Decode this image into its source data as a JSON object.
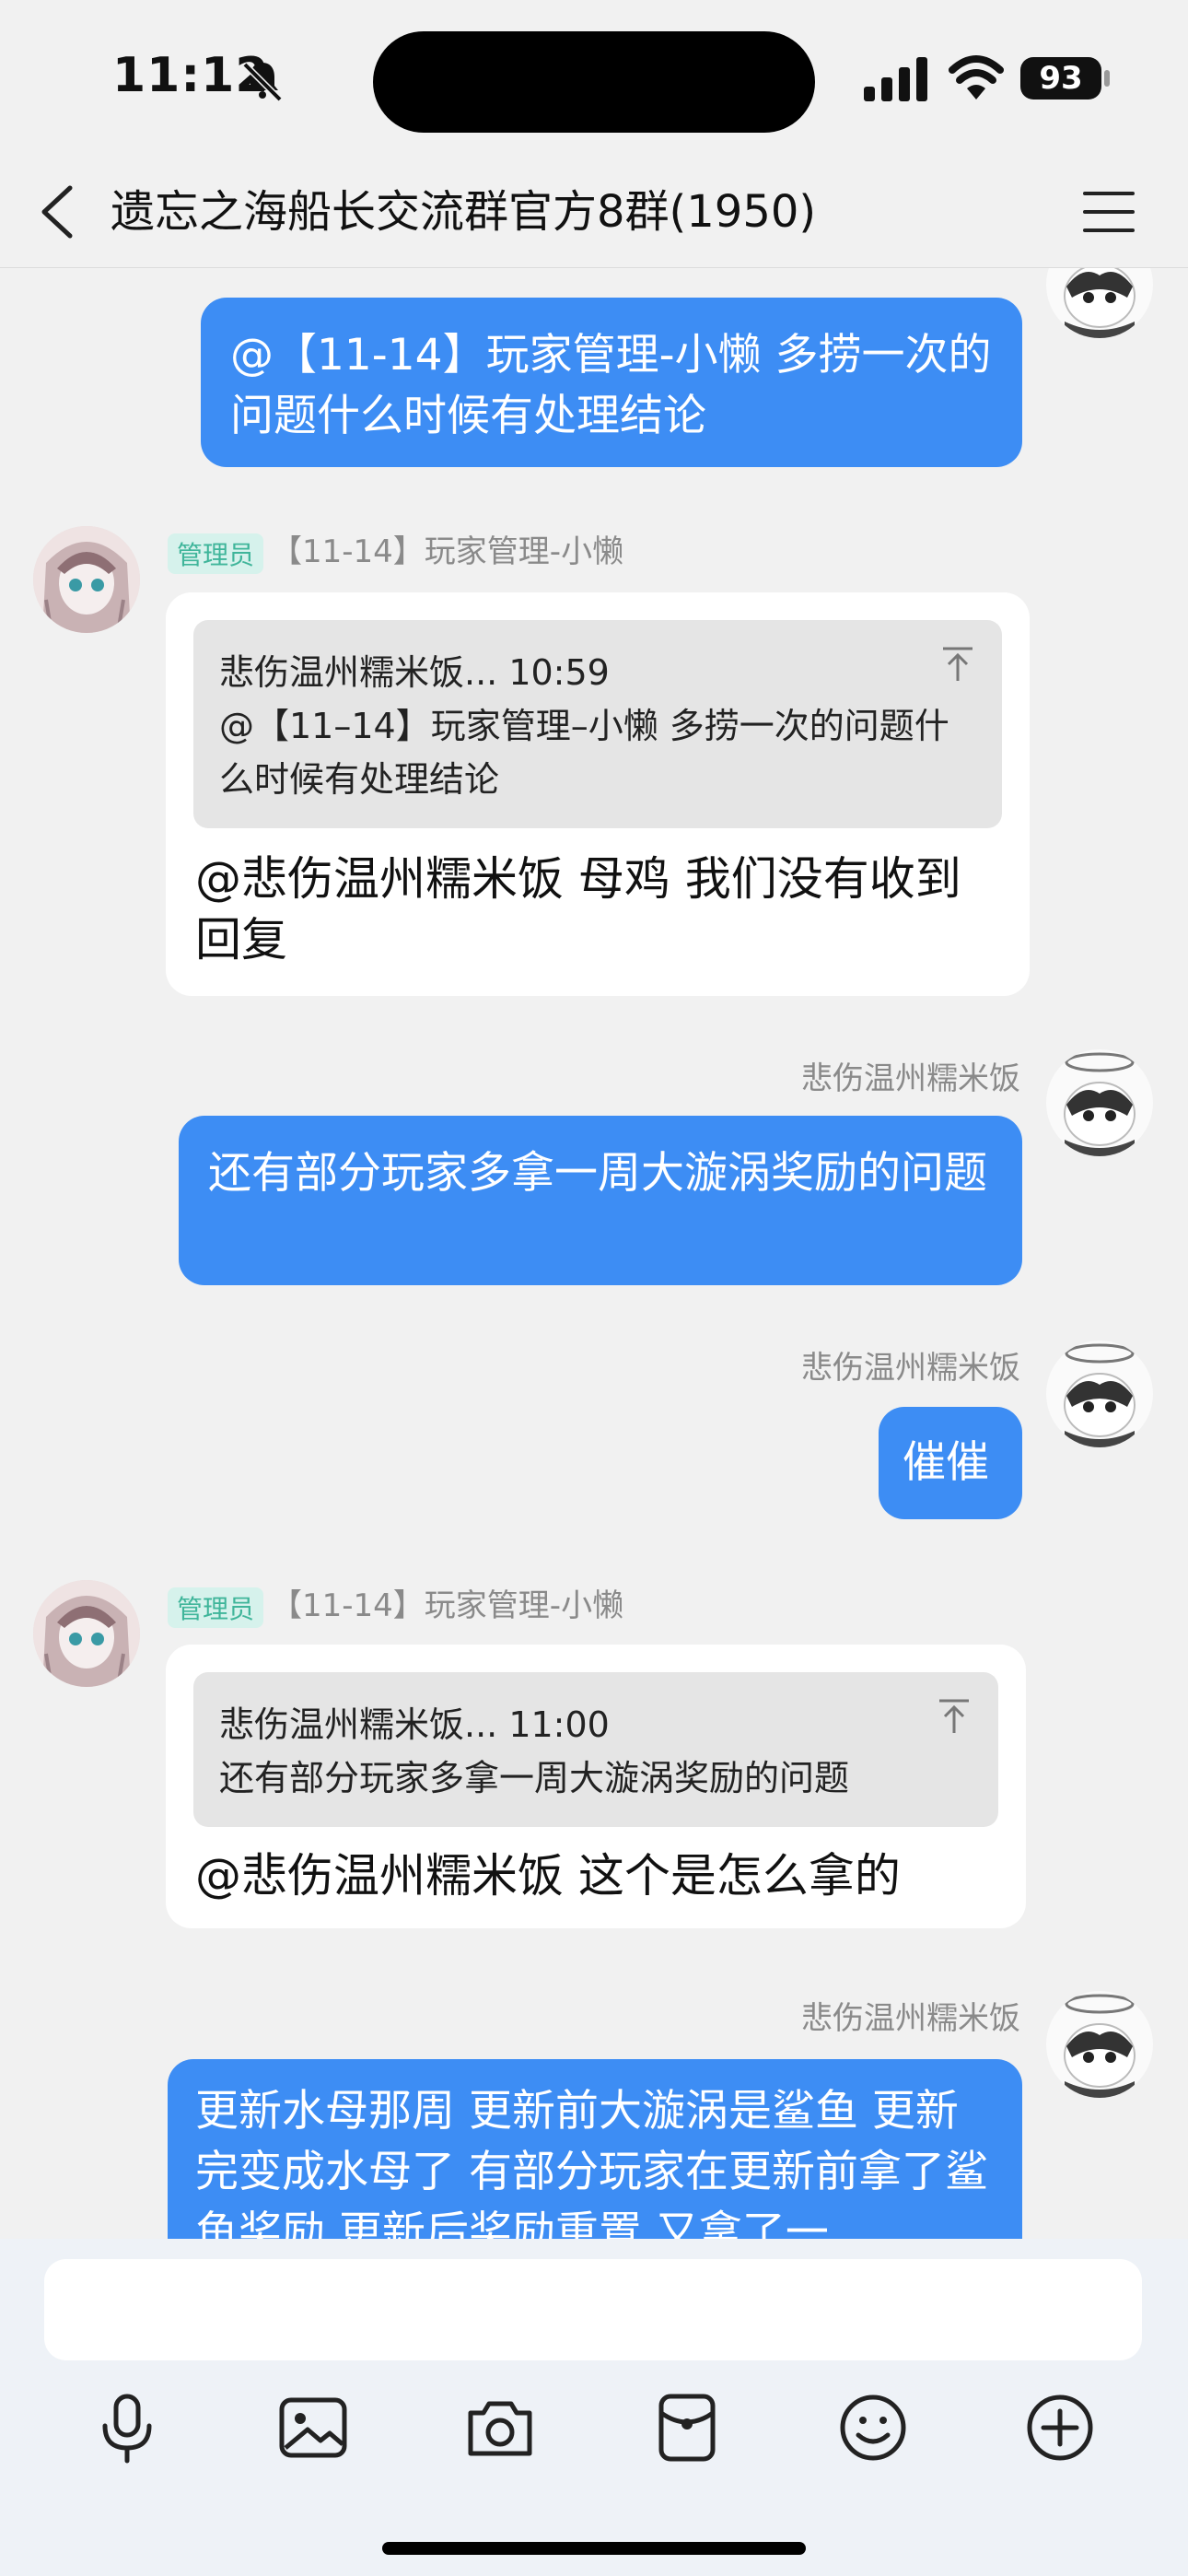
{
  "status": {
    "time": "11:12",
    "battery": "93"
  },
  "header": {
    "title": "遗忘之海船长交流群官方8群(1950)"
  },
  "messages": {
    "m1": {
      "text": "@【11-14】玩家管理-小懒 多捞一次的问题什么时候有处理结论"
    },
    "m2": {
      "badge": "管理员",
      "sender": "【11-14】玩家管理-小懒",
      "quote_head": "悲伤温州糯米饭... 10:59",
      "quote_body": "@【11–14】玩家管理–小懒 多捞一次的问题什么时候有处理结论",
      "reply": "@悲伤温州糯米饭 母鸡 我们没有收到回复"
    },
    "m3": {
      "sender": "悲伤温州糯米饭",
      "text": "还有部分玩家多拿一周大漩涡奖励的问题"
    },
    "m4": {
      "sender": "悲伤温州糯米饭",
      "text": "催催"
    },
    "m5": {
      "badge": "管理员",
      "sender": "【11-14】玩家管理-小懒",
      "quote_head": "悲伤温州糯米饭... 11:00",
      "quote_body": "还有部分玩家多拿一周大漩涡奖励的问题",
      "reply": "@悲伤温州糯米饭 这个是怎么拿的"
    },
    "m6": {
      "sender": "悲伤温州糯米饭",
      "text": "更新水母那周 更新前大漩涡是鲨鱼 更新完变成水母了 有部分玩家在更新前拿了鲨鱼奖励 更新后奖励重置 又拿了一"
    }
  },
  "input": {
    "placeholder": ""
  },
  "icons": {
    "toolbar": [
      "microphone-icon",
      "image-icon",
      "camera-icon",
      "red-packet-icon",
      "emoji-icon",
      "plus-icon"
    ]
  },
  "colors": {
    "bubble_out": "#3d8df4",
    "admin_badge_bg": "#d6f2ec",
    "admin_badge_text": "#3fb59a"
  }
}
